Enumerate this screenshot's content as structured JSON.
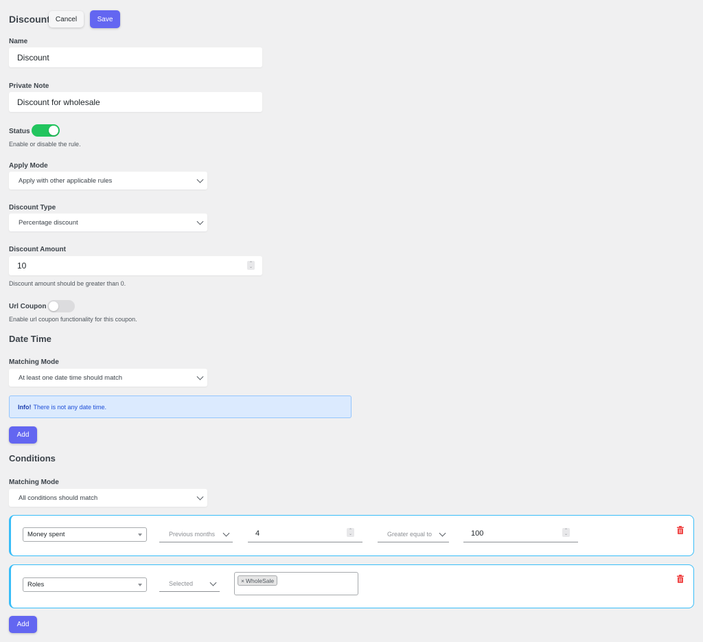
{
  "header": {
    "title": "Discount",
    "cancel_label": "Cancel",
    "save_label": "Save"
  },
  "name": {
    "label": "Name",
    "value": "Discount"
  },
  "private_note": {
    "label": "Private Note",
    "value": "Discount for wholesale"
  },
  "status": {
    "label": "Status",
    "enabled": true,
    "help": "Enable or disable the rule."
  },
  "apply_mode": {
    "label": "Apply Mode",
    "value": "Apply with other applicable rules"
  },
  "discount_type": {
    "label": "Discount Type",
    "value": "Percentage discount"
  },
  "discount_amount": {
    "label": "Discount Amount",
    "value": "10",
    "help": "Discount amount should be greater than 0."
  },
  "url_coupon": {
    "label": "Url Coupon",
    "enabled": false,
    "help": "Enable url coupon functionality for this coupon."
  },
  "date_time": {
    "title": "Date Time",
    "matching_mode_label": "Matching Mode",
    "matching_mode_value": "At least one date time should match",
    "info_strong": "Info!",
    "info_text": "There is not any date time.",
    "add_label": "Add"
  },
  "conditions": {
    "title": "Conditions",
    "matching_mode_label": "Matching Mode",
    "matching_mode_value": "All conditions should match",
    "add_label": "Add",
    "items": [
      {
        "type": "Money spent",
        "period": "Previous months",
        "period_value": "4",
        "operator": "Greater equal to",
        "amount": "100"
      },
      {
        "type": "Roles",
        "operator": "Selected",
        "tags": [
          "WholeSale"
        ]
      }
    ]
  },
  "colors": {
    "primary": "#6366f1",
    "toggle_on": "#22c55e",
    "toggle_off": "#dcdcde",
    "card_border": "#38bdf8",
    "delete": "#ef4444",
    "info_bg": "#dbeafe"
  }
}
